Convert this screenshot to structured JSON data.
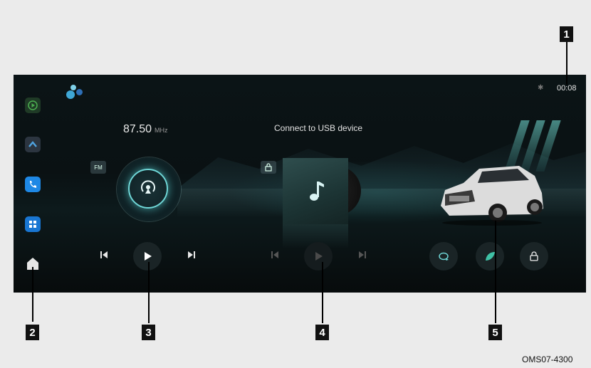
{
  "status_bar": {
    "clock": "00:08",
    "bluetooth_icon": "bluetooth-icon"
  },
  "sidebar": {
    "items": [
      {
        "name": "carplay-app",
        "icon": "play-circle-icon",
        "color": "#2e7d32"
      },
      {
        "name": "navigation-app",
        "icon": "caret-up-icon",
        "color": "#3a4a5a"
      },
      {
        "name": "phone-app",
        "icon": "phone-icon",
        "color": "#1e88e5"
      },
      {
        "name": "apps-grid",
        "icon": "grid-icon",
        "color": "#1976d2"
      },
      {
        "name": "home",
        "icon": "home-icon",
        "color": "#e0e0e0"
      }
    ]
  },
  "radio": {
    "frequency": "87.50",
    "unit": "MHz",
    "band": "FM",
    "prev_icon": "skip-previous-icon",
    "play_icon": "play-icon",
    "next_icon": "skip-next-icon"
  },
  "media": {
    "status": "Connect to USB device",
    "source_icon": "usb-lock-icon",
    "note_icon": "music-note-icon"
  },
  "vehicle": {
    "controls": [
      "refresh-icon",
      "leaf-icon",
      "lock-icon"
    ]
  },
  "callouts": [
    "1",
    "2",
    "3",
    "4",
    "5"
  ],
  "reference_code": "OMS07-4300",
  "colors": {
    "accent": "#6fd6d6",
    "screen_bg": "#0b1416",
    "page_bg": "#ebebeb"
  }
}
